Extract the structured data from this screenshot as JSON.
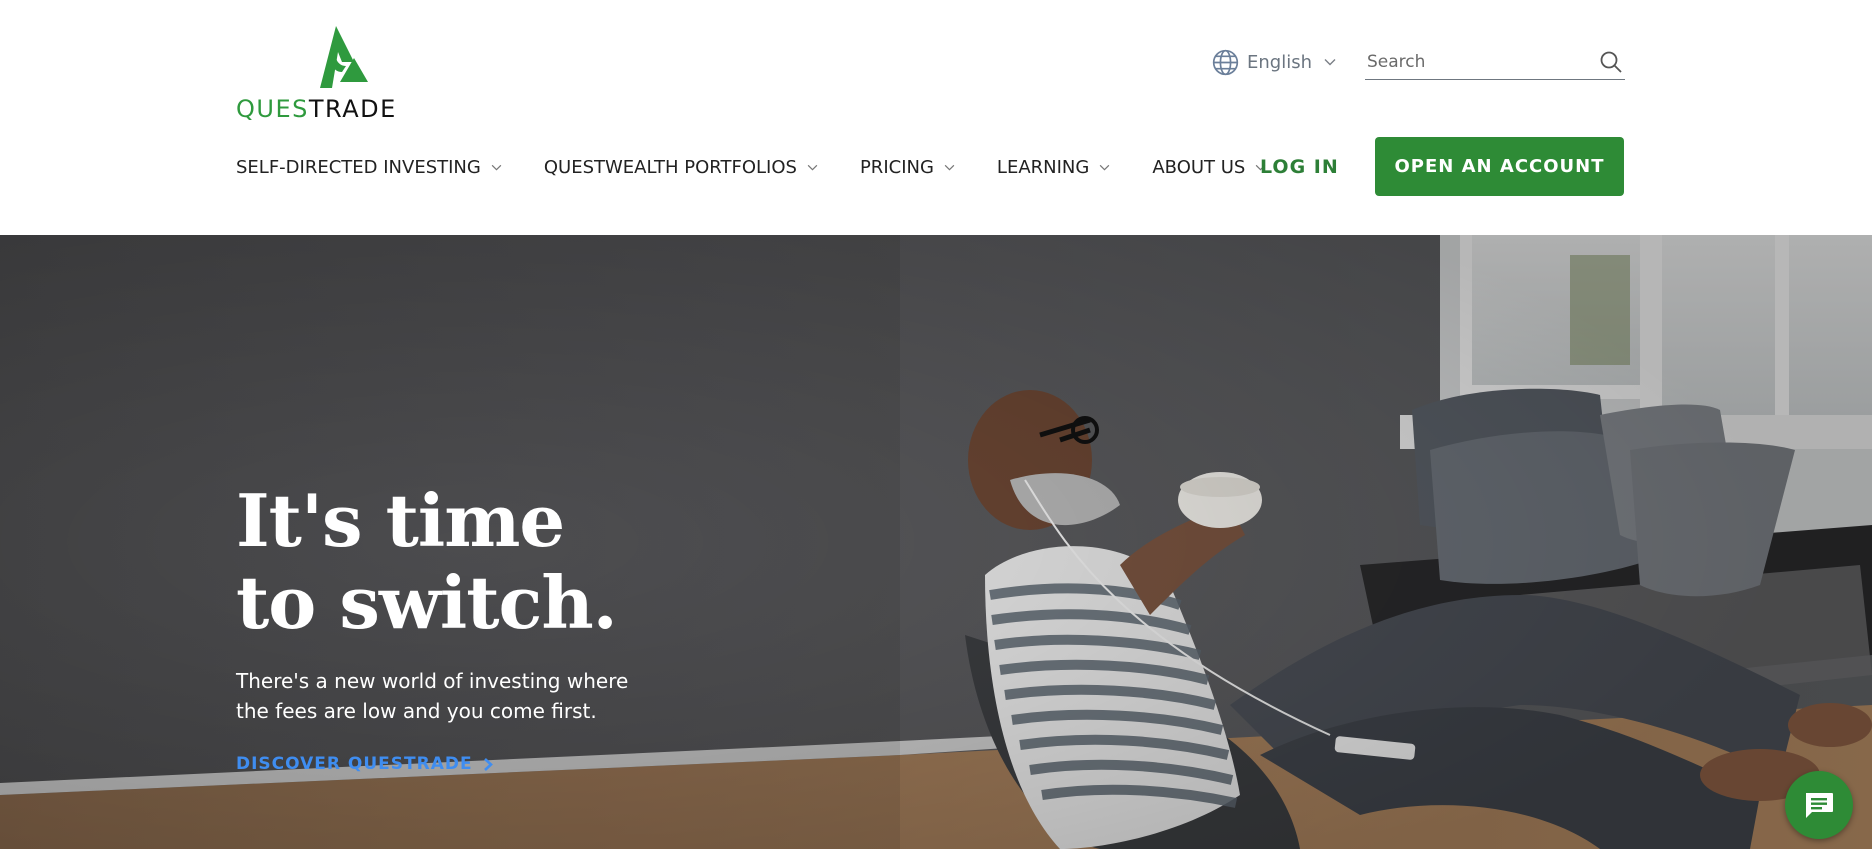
{
  "brand": {
    "name_green": "QUES",
    "name_black": "TRADE",
    "logo_icon": "questrade-logo-icon",
    "accent_color": "#2e8b36"
  },
  "utility": {
    "language_label": "English",
    "language_icon": "globe-icon",
    "search_placeholder": "Search",
    "search_icon": "search-icon"
  },
  "nav": {
    "items": [
      {
        "label": "SELF-DIRECTED INVESTING"
      },
      {
        "label": "QUESTWEALTH PORTFOLIOS"
      },
      {
        "label": "PRICING"
      },
      {
        "label": "LEARNING"
      },
      {
        "label": "ABOUT US"
      }
    ],
    "login_label": "LOG IN",
    "open_account_label": "OPEN AN ACCOUNT"
  },
  "hero": {
    "title_line1": "It's time",
    "title_line2": "to switch.",
    "subtitle": "There's a new world of investing where the fees are low and you come first.",
    "cta_label": "DISCOVER QUESTRADE",
    "cta_icon": "chevron-right-icon",
    "photo": "man-relaxing-with-coffee-photo"
  },
  "chat": {
    "icon": "chat-bubble-icon"
  }
}
